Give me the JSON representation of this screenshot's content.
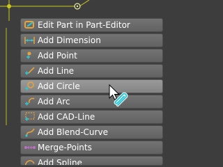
{
  "menu": {
    "items": [
      {
        "label": "Edit Part in Part-Editor",
        "icon": "edit-part-icon"
      },
      {
        "label": "Add Dimension",
        "icon": "dimension-icon"
      },
      {
        "label": "Add Point",
        "icon": "point-icon"
      },
      {
        "label": "Add Line",
        "icon": "line-icon"
      },
      {
        "label": "Add Circle",
        "icon": "circle-icon"
      },
      {
        "label": "Add Arc",
        "icon": "arc-icon"
      },
      {
        "label": "Add CAD-Line",
        "icon": "cad-line-icon"
      },
      {
        "label": "Add Blend-Curve",
        "icon": "blend-curve-icon"
      },
      {
        "label": "Merge-Points",
        "icon": "merge-points-icon"
      },
      {
        "label": "Add Spline",
        "icon": "spline-icon"
      }
    ],
    "hovered_item": "Add Circle"
  },
  "colors": {
    "background": "#3d3d3d",
    "menu_item": "#6a6a6a",
    "menu_item_hover": "#8f8f8f",
    "accent_orange": "#e8a23a",
    "accent_cyan": "#2ec7d6",
    "canvas_line": "#c9c91a"
  }
}
